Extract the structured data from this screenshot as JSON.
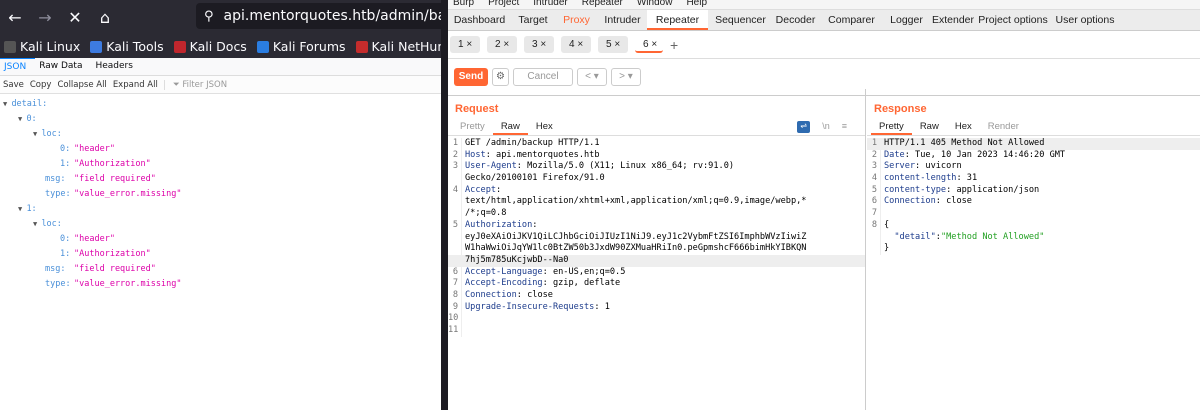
{
  "browser": {
    "url": "api.mentorquotes.htb/admin/backup",
    "bookmarks": [
      "Kali Linux",
      "Kali Tools",
      "Kali Docs",
      "Kali Forums",
      "Kali NetHunter"
    ],
    "viewer_tabs": [
      "JSON",
      "Raw Data",
      "Headers"
    ],
    "toolbar": [
      "Save",
      "Copy",
      "Collapse All",
      "Expand All"
    ],
    "filter_placeholder": "Filter JSON",
    "tree": [
      {
        "d": 0,
        "t": true,
        "k": "detail:",
        "v": ""
      },
      {
        "d": 1,
        "t": true,
        "k": "0:",
        "v": ""
      },
      {
        "d": 2,
        "t": true,
        "k": "loc:",
        "v": ""
      },
      {
        "d": 3,
        "t": false,
        "k": "0:",
        "v": "\"header\""
      },
      {
        "d": 3,
        "t": false,
        "k": "1:",
        "v": "\"Authorization\""
      },
      {
        "d": 2,
        "t": false,
        "k": "msg:",
        "v": "\"field required\""
      },
      {
        "d": 2,
        "t": false,
        "k": "type:",
        "v": "\"value_error.missing\""
      },
      {
        "d": 1,
        "t": true,
        "k": "1:",
        "v": ""
      },
      {
        "d": 2,
        "t": true,
        "k": "loc:",
        "v": ""
      },
      {
        "d": 3,
        "t": false,
        "k": "0:",
        "v": "\"header\""
      },
      {
        "d": 3,
        "t": false,
        "k": "1:",
        "v": "\"Authorization\""
      },
      {
        "d": 2,
        "t": false,
        "k": "msg:",
        "v": "\"field required\""
      },
      {
        "d": 2,
        "t": false,
        "k": "type:",
        "v": "\"value_error.missing\""
      }
    ]
  },
  "burp": {
    "menu": [
      "Burp",
      "Project",
      "Intruder",
      "Repeater",
      "Window",
      "Help"
    ],
    "tabs": [
      "Dashboard",
      "Target",
      "Proxy",
      "Intruder",
      "Repeater",
      "Sequencer",
      "Decoder",
      "Comparer",
      "Logger",
      "Extender",
      "Project options",
      "User options"
    ],
    "repeater_tabs": [
      "1 ×",
      "2 ×",
      "3 ×",
      "4 ×",
      "5 ×",
      "6 ×"
    ],
    "send": "Send",
    "cancel": "Cancel",
    "request": {
      "title": "Request",
      "tabs": [
        "Pretty",
        "Raw",
        "Hex"
      ],
      "newline_icon": "\\n",
      "lines": [
        {
          "n": "1",
          "k": "",
          "v": "GET /admin/backup HTTP/1.1"
        },
        {
          "n": "2",
          "k": "Host",
          "v": ": api.mentorquotes.htb"
        },
        {
          "n": "3",
          "k": "User-Agent",
          "v": ": Mozilla/5.0 (X11; Linux x86_64; rv:91.0)"
        },
        {
          "n": "",
          "k": "",
          "v": "Gecko/20100101 Firefox/91.0"
        },
        {
          "n": "4",
          "k": "Accept",
          "v": ":"
        },
        {
          "n": "",
          "k": "",
          "v": "text/html,application/xhtml+xml,application/xml;q=0.9,image/webp,*"
        },
        {
          "n": "",
          "k": "",
          "v": "/*;q=0.8"
        },
        {
          "n": "5",
          "k": "Authorization",
          "v": ":"
        },
        {
          "n": "",
          "k": "",
          "v": "eyJ0eXAiOiJKV1QiLCJhbGciOiJIUzI1NiJ9.eyJ1c2VybmFtZSI6ImphbWVzIiwiZ"
        },
        {
          "n": "",
          "k": "",
          "v": "W1haWwiOiJqYW1lc0BtZW50b3JxdW90ZXMuaHRiIn0.peGpmshcF666bimHkYIBKQN"
        },
        {
          "n": "",
          "k": "",
          "v": "7hj5m785uKcjwbD--Na0",
          "hl": true
        },
        {
          "n": "6",
          "k": "Accept-Language",
          "v": ": en-US,en;q=0.5"
        },
        {
          "n": "7",
          "k": "Accept-Encoding",
          "v": ": gzip, deflate"
        },
        {
          "n": "8",
          "k": "Connection",
          "v": ": close"
        },
        {
          "n": "9",
          "k": "Upgrade-Insecure-Requests",
          "v": ": 1"
        },
        {
          "n": "10",
          "k": "",
          "v": ""
        },
        {
          "n": "11",
          "k": "",
          "v": ""
        }
      ]
    },
    "response": {
      "title": "Response",
      "tabs": [
        "Pretty",
        "Raw",
        "Hex",
        "Render"
      ],
      "lines": [
        {
          "n": "1",
          "k": "",
          "v": "HTTP/1.1 405 Method Not Allowed",
          "hl": true
        },
        {
          "n": "2",
          "k": "Date",
          "v": ": Tue, 10 Jan 2023 14:46:20 GMT"
        },
        {
          "n": "3",
          "k": "Server",
          "v": ": uvicorn"
        },
        {
          "n": "4",
          "k": "content-length",
          "v": ": 31"
        },
        {
          "n": "5",
          "k": "content-type",
          "v": ": application/json"
        },
        {
          "n": "6",
          "k": "Connection",
          "v": ": close"
        },
        {
          "n": "7",
          "k": "",
          "v": ""
        },
        {
          "n": "8",
          "k": "",
          "v": "{"
        },
        {
          "n": "",
          "k": "  \"detail\"",
          "v": ":",
          "j": "\"Method Not Allowed\""
        },
        {
          "n": "",
          "k": "",
          "v": "}"
        }
      ]
    }
  },
  "colors": {
    "accent": "#ff6633",
    "json_key": "#4a90d9",
    "json_value": "#dd00a9"
  }
}
